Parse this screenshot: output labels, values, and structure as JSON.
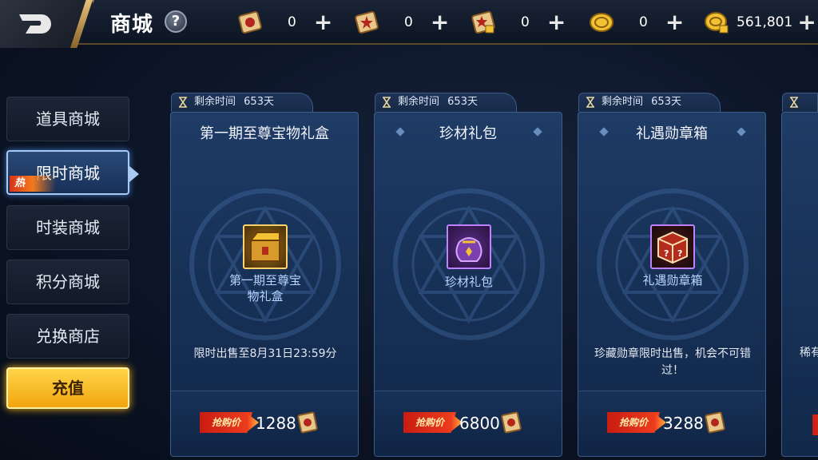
{
  "header": {
    "title": "商城",
    "help_icon": "?",
    "currencies": [
      {
        "icon": "scroll-red-icon",
        "value": "0"
      },
      {
        "icon": "scroll-star-icon",
        "value": "0"
      },
      {
        "icon": "scroll-locked-icon",
        "value": "0"
      },
      {
        "icon": "gold-coin-icon",
        "value": "0"
      },
      {
        "icon": "coin-locked-icon",
        "value": "561,801"
      }
    ],
    "plus": "+"
  },
  "sidebar": {
    "items": [
      {
        "label": "道具商城"
      },
      {
        "label": "限时商城",
        "active": true,
        "badge": "热"
      },
      {
        "label": "时装商城"
      },
      {
        "label": "积分商城"
      },
      {
        "label": "兑换商店"
      }
    ],
    "recharge_label": "充值"
  },
  "shop": {
    "timer_label": "剩余时间",
    "items": [
      {
        "remaining": "653天",
        "title": "第一期至尊宝物礼盒",
        "icon": "gold-treasure-box-icon",
        "name": "第一期至尊宝物礼盒",
        "description": "限时出售至8月31日23:59分",
        "price_tag": "抢购价",
        "price": "1288"
      },
      {
        "remaining": "653天",
        "title": "珍材礼包",
        "icon": "purple-bag-icon",
        "name": "珍材礼包",
        "description": "",
        "price_tag": "抢购价",
        "price": "6800"
      },
      {
        "remaining": "653天",
        "title": "礼遇勋章箱",
        "icon": "mystery-box-icon",
        "name": "礼遇勋章箱",
        "description": "珍藏勋章限时出售，机会不可错过！",
        "price_tag": "抢购价",
        "price": "3288"
      }
    ],
    "partial_text": "稀有"
  },
  "colors": {
    "accent_gold": "#f1a40f",
    "active_blue": "#a9c8f2",
    "panel_blue": "#173157",
    "price_red": "#c91c12"
  }
}
